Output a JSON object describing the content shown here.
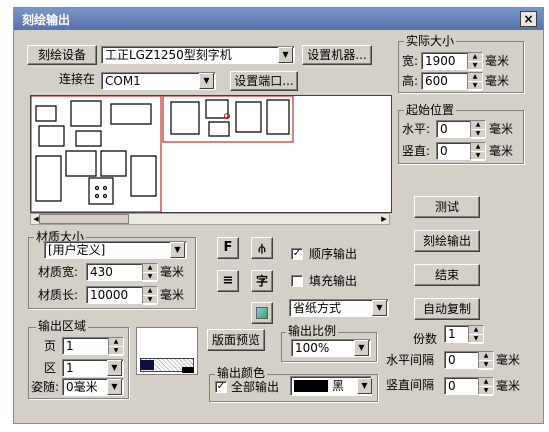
{
  "window": {
    "title": "刻绘输出",
    "close": "×"
  },
  "device": {
    "button": "刻绘设备",
    "selected": "工正LGZ1250型刻字机",
    "setup_button": "设置机器..."
  },
  "port": {
    "label": "连接在",
    "selected": "COM1",
    "setup_button": "设置端口..."
  },
  "actual_size": {
    "group": "实际大小",
    "width_label": "宽:",
    "width": "1900",
    "height_label": "高:",
    "height": "600",
    "unit": "毫米"
  },
  "start_pos": {
    "group": "起始位置",
    "h_label": "水平:",
    "h": "0",
    "v_label": "竖直:",
    "v": "0",
    "unit": "毫米"
  },
  "material": {
    "group": "材质大小",
    "type": "[用户定义]",
    "width_label": "材质宽:",
    "width": "430",
    "length_label": "材质长:",
    "length": "10000",
    "unit": "毫米"
  },
  "tools": {
    "f": "F",
    "sym": "⫛",
    "lines": "≡",
    "char": "字"
  },
  "options": {
    "sequential": "顺序输出",
    "sequential_checked": true,
    "fill": "填充输出",
    "fill_checked": false,
    "paper_mode": "省纸方式"
  },
  "output_area": {
    "group": "输出区域",
    "page_label": "页",
    "page": "1",
    "zone_label": "区",
    "zone": "1",
    "cut_label": "姿随:",
    "cut": "0毫米"
  },
  "preview_btn": "版面预览",
  "scale": {
    "group": "输出比例",
    "value": "100%"
  },
  "color": {
    "group": "输出颜色",
    "all_label": "全部输出",
    "all_checked": true,
    "color_name": "黑"
  },
  "actions": {
    "test": "测试",
    "cut_output": "刻绘输出",
    "end": "结束",
    "auto_copy": "自动复制"
  },
  "copies": {
    "label": "份数",
    "value": "1",
    "h_gap_label": "水平间隔",
    "h_gap": "0",
    "v_gap_label": "竖直间隔",
    "v_gap": "0",
    "unit": "毫米"
  }
}
